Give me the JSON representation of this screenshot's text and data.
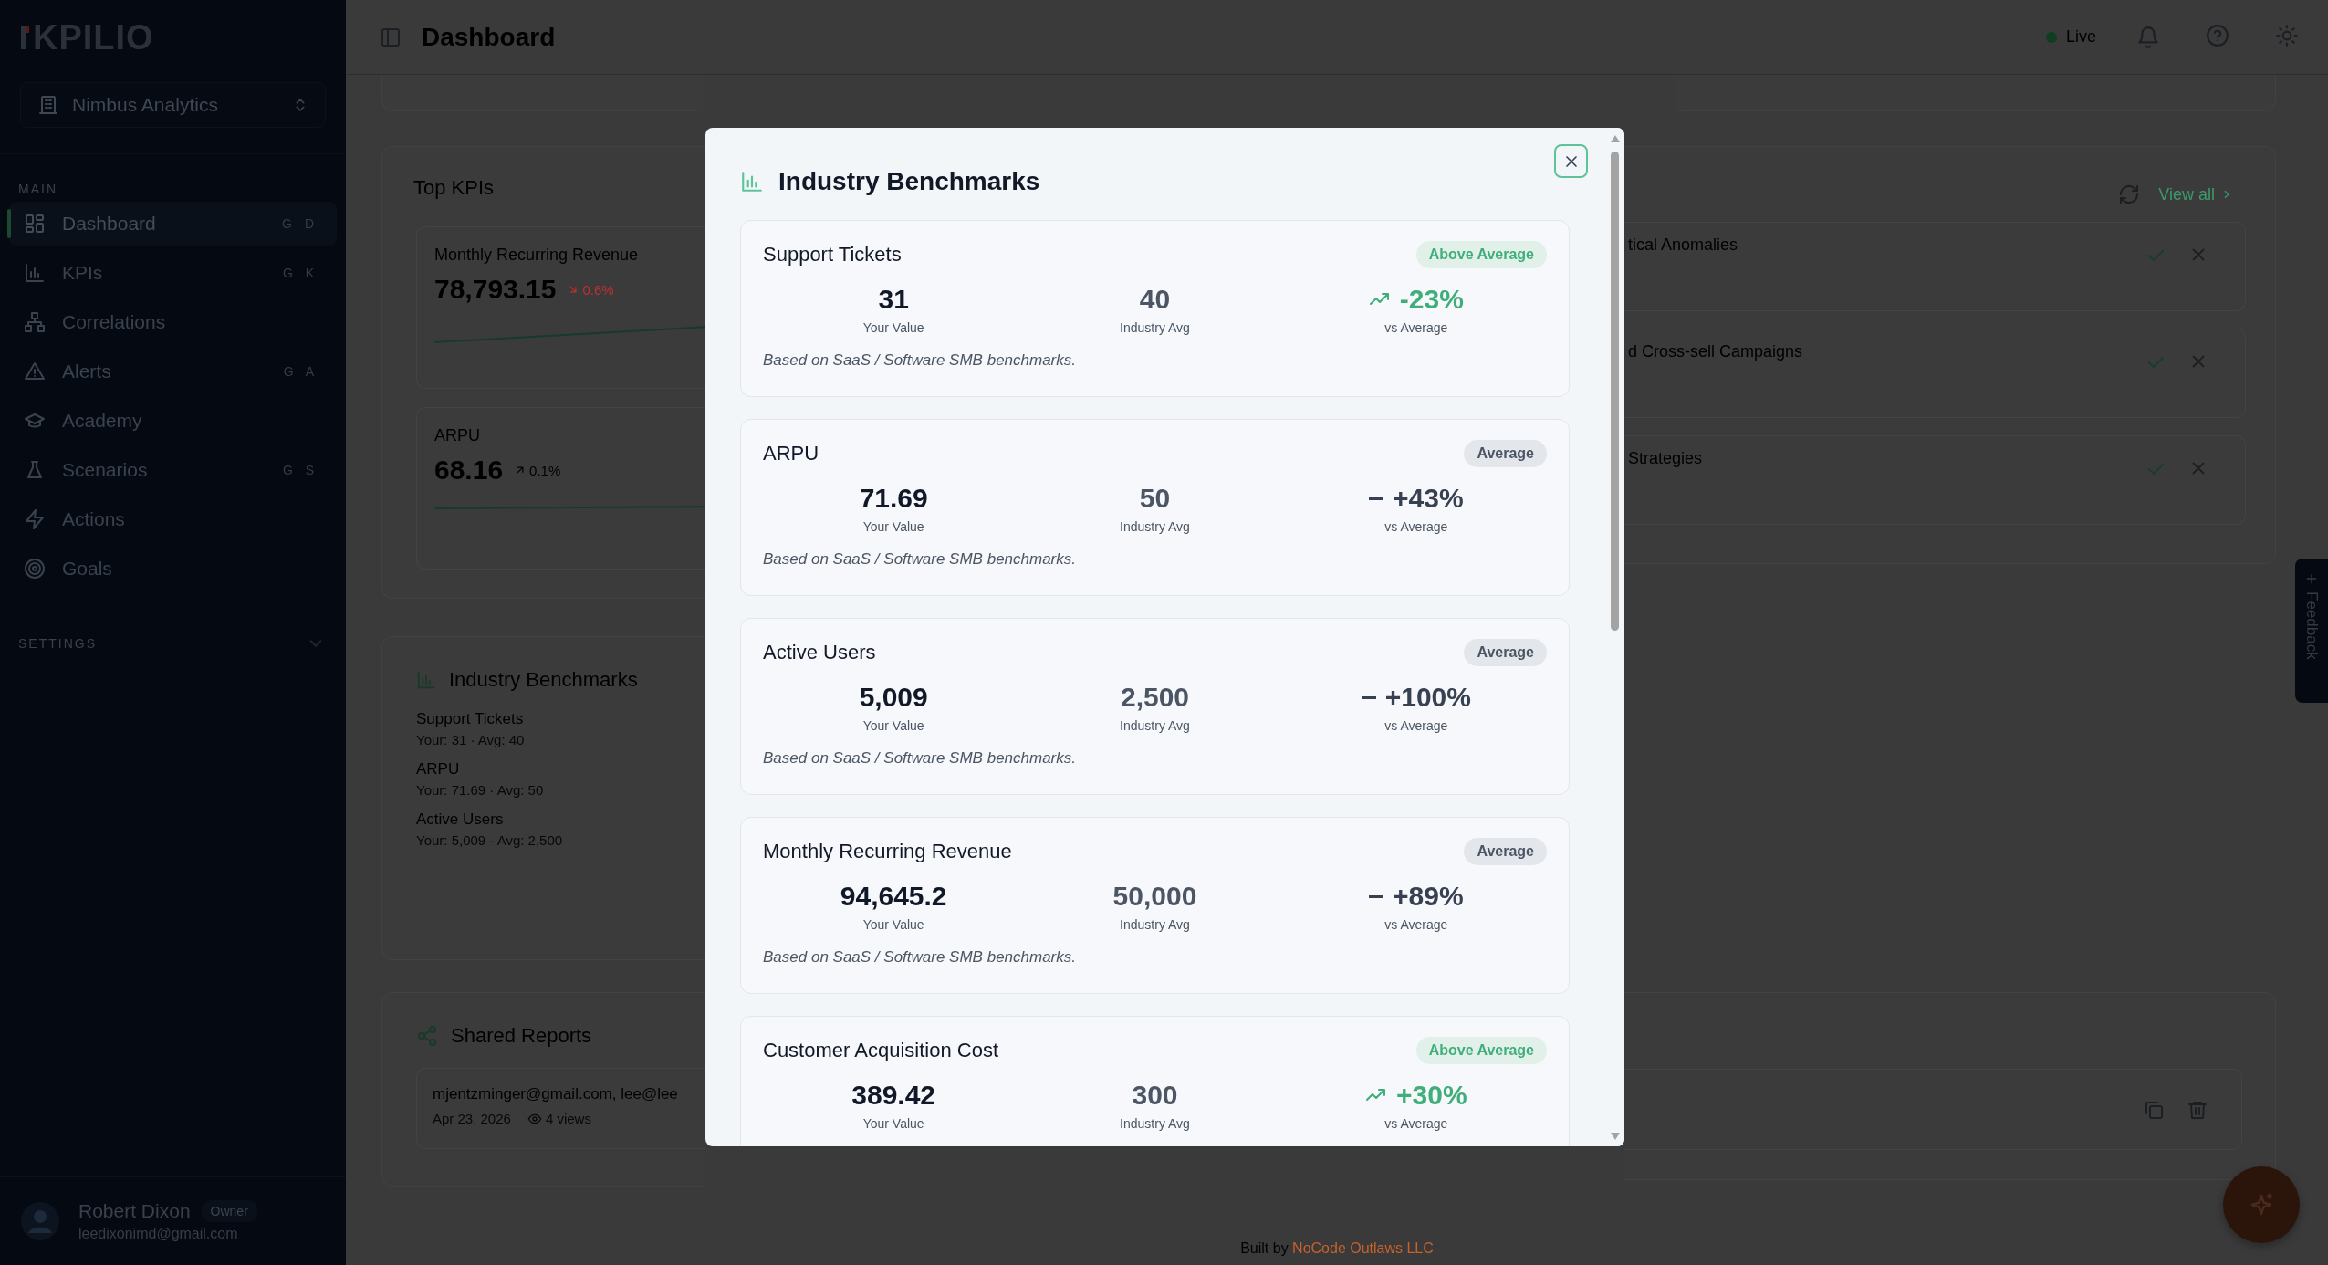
{
  "sidebar": {
    "logo": "KPILIO",
    "workspace": "Nimbus Analytics",
    "main_label": "MAIN",
    "items": [
      {
        "label": "Dashboard",
        "shortcut": "G D",
        "selected": true
      },
      {
        "label": "KPIs",
        "shortcut": "G K",
        "selected": false
      },
      {
        "label": "Correlations",
        "selected": false
      },
      {
        "label": "Alerts",
        "shortcut": "G A",
        "selected": false
      },
      {
        "label": "Academy",
        "selected": false
      },
      {
        "label": "Scenarios",
        "shortcut": "G S",
        "selected": false
      },
      {
        "label": "Actions",
        "selected": false
      },
      {
        "label": "Goals",
        "selected": false
      }
    ],
    "settings_label": "SETTINGS",
    "user": {
      "name": "Robert Dixon",
      "role": "Owner",
      "email": "leedixonimd@gmail.com"
    }
  },
  "header": {
    "title": "Dashboard",
    "status": "Live"
  },
  "top_kpis": {
    "title": "Top KPIs",
    "cards": [
      {
        "name": "Monthly Recurring Revenue",
        "value": "78,793.15",
        "change": "0.6%",
        "kind": "falling"
      },
      {
        "name": "ARPU",
        "value": "68.16",
        "change": "0.1%",
        "kind": "rising"
      }
    ]
  },
  "benchmarks_panel": {
    "title": "Industry Benchmarks",
    "items": [
      {
        "name": "Support Tickets",
        "detail": "Your: 31 · Avg: 40"
      },
      {
        "name": "ARPU",
        "detail": "Your: 71.69 · Avg: 50"
      },
      {
        "name": "Active Users",
        "detail": "Your: 5,009 · Avg: 2,500"
      }
    ]
  },
  "shared_reports": {
    "title": "Shared Reports",
    "reports": [
      {
        "recipients": "mjentzminger@gmail.com, lee@lee",
        "date": "Apr 23, 2026",
        "views": "4 views"
      }
    ]
  },
  "actions_panel": {
    "link": "View all",
    "items": [
      {
        "title": "tical Anomalies"
      },
      {
        "title": "d Cross-sell Campaigns"
      },
      {
        "title": "Strategies"
      }
    ]
  },
  "feedback": "Feedback",
  "footer": {
    "text": "Built by",
    "link": "NoCode Outlaws LLC"
  },
  "modal": {
    "title": "Industry Benchmarks",
    "cards": [
      {
        "title": "Support Tickets",
        "rating": "Above Average",
        "kind": "above",
        "your_value": "31",
        "your_label": "Your Value",
        "industry_avg": "40",
        "avg_label": "Industry Avg",
        "delta": "-23%",
        "delta_label": "vs Average",
        "note": "Based on SaaS / Software SMB benchmarks."
      },
      {
        "title": "ARPU",
        "rating": "Average",
        "kind": "average",
        "your_value": "71.69",
        "your_label": "Your Value",
        "industry_avg": "50",
        "avg_label": "Industry Avg",
        "delta": "+43%",
        "delta_label": "vs Average",
        "note": "Based on SaaS / Software SMB benchmarks."
      },
      {
        "title": "Active Users",
        "rating": "Average",
        "kind": "average",
        "your_value": "5,009",
        "your_label": "Your Value",
        "industry_avg": "2,500",
        "avg_label": "Industry Avg",
        "delta": "+100%",
        "delta_label": "vs Average",
        "note": "Based on SaaS / Software SMB benchmarks."
      },
      {
        "title": "Monthly Recurring Revenue",
        "rating": "Average",
        "kind": "average",
        "your_value": "94,645.2",
        "your_label": "Your Value",
        "industry_avg": "50,000",
        "avg_label": "Industry Avg",
        "delta": "+89%",
        "delta_label": "vs Average",
        "note": "Based on SaaS / Software SMB benchmarks."
      },
      {
        "title": "Customer Acquisition Cost",
        "rating": "Above Average",
        "kind": "above",
        "your_value": "389.42",
        "your_label": "Your Value",
        "industry_avg": "300",
        "avg_label": "Industry Avg",
        "delta": "+30%",
        "delta_label": "vs Average"
      }
    ]
  }
}
